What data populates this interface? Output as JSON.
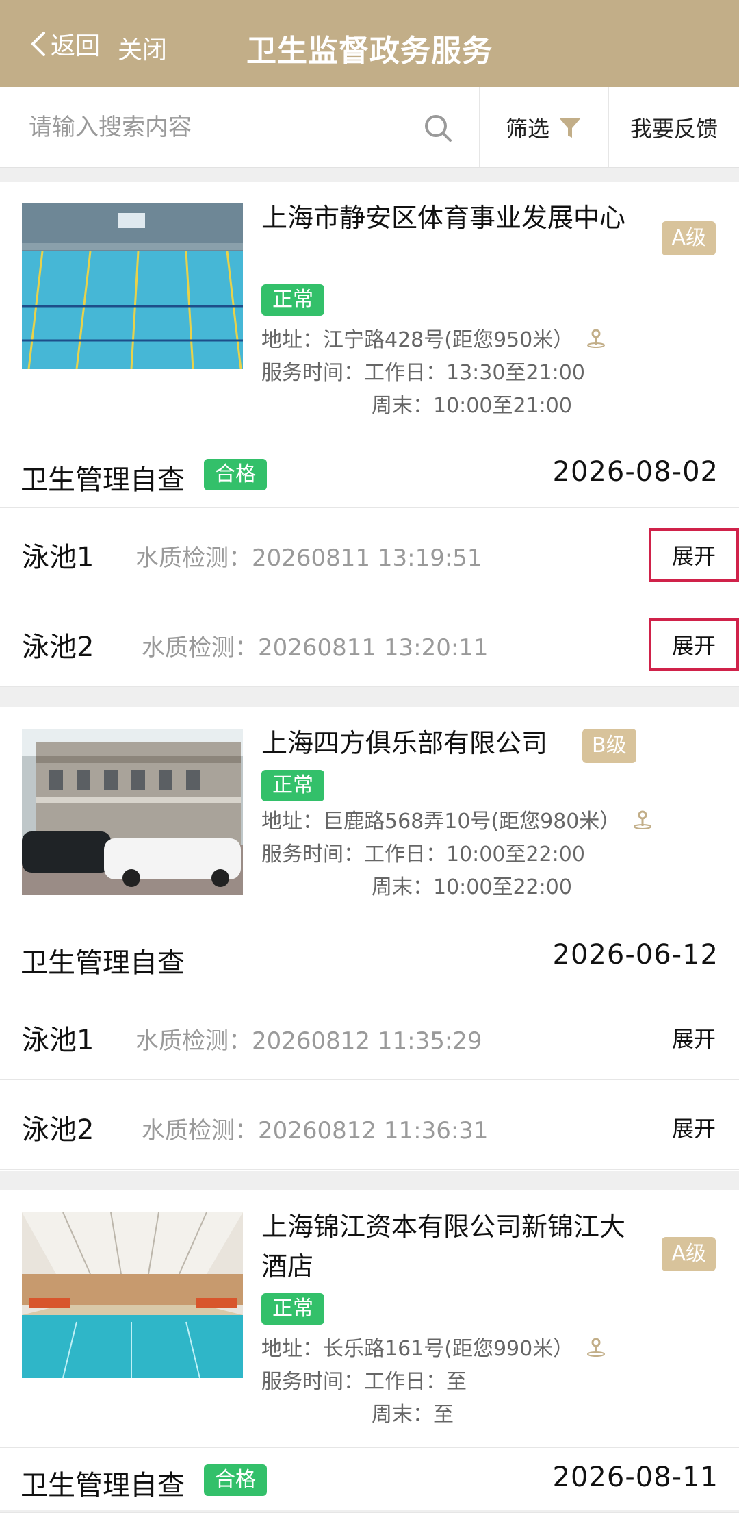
{
  "nav": {
    "back_label": "返回",
    "close_label": "关闭",
    "title": "卫生监督政务服务"
  },
  "search": {
    "placeholder": "请输入搜索内容",
    "filter_label": "筛选",
    "feedback_label": "我要反馈"
  },
  "venues": [
    {
      "name": "上海市静安区体育事业发展中心",
      "grade": "A级",
      "status": "正常",
      "address": "地址：江宁路428号(距您950米）",
      "hours_weekday": "服务时间：工作日：13:30至21:00",
      "hours_weekend": "周末：10:00至21:00",
      "check_title": "卫生管理自查",
      "check_badge": "合格",
      "check_date": "2026-08-02",
      "pools": [
        {
          "name": "泳池1",
          "info": "水质检测：20260811 13:19:51",
          "action": "展开"
        },
        {
          "name": "泳池2",
          "info": "水质检测：20260811 13:20:11",
          "action": "展开"
        }
      ]
    },
    {
      "name": "上海四方俱乐部有限公司",
      "grade": "B级",
      "status": "正常",
      "address": "地址：巨鹿路568弄10号(距您980米）",
      "hours_weekday": "服务时间：工作日：10:00至22:00",
      "hours_weekend": "周末：10:00至22:00",
      "check_title": "卫生管理自查",
      "check_badge": "",
      "check_date": "2026-06-12",
      "pools": [
        {
          "name": "泳池1",
          "info": "水质检测：20260812 11:35:29",
          "action": "展开"
        },
        {
          "name": "泳池2",
          "info": "水质检测：20260812 11:36:31",
          "action": "展开"
        }
      ]
    },
    {
      "name": "上海锦江资本有限公司新锦江大酒店",
      "grade": "A级",
      "status": "正常",
      "address": "地址：长乐路161号(距您990米）",
      "hours_weekday": "服务时间：工作日：至",
      "hours_weekend": "周末：至",
      "check_title": "卫生管理自查",
      "check_badge": "合格",
      "check_date": "2026-08-11"
    }
  ],
  "colors": {
    "nav_bg": "#c2ae88",
    "grade_bg": "#d8c39b",
    "status_green": "#33c06a",
    "highlight_red": "#d0224a"
  }
}
